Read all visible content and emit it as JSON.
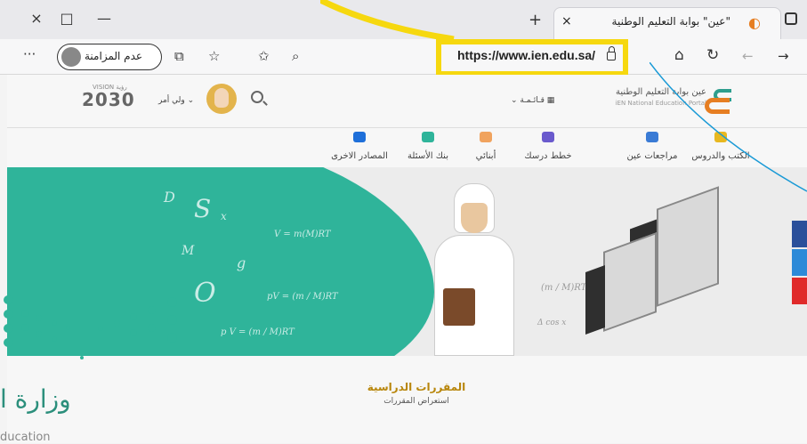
{
  "browser": {
    "tab": {
      "title": "\"عين\" بوابة التعليم الوطنية",
      "close_glyph": "×",
      "favicon": "ien-favicon-icon"
    },
    "window_controls": {
      "close": "×",
      "maximize": "□",
      "minimize": "—"
    },
    "new_tab_glyph": "+",
    "toolbar": {
      "more_glyph": "···",
      "profile_label": "عدم المزامنة",
      "url": "https://www.ien.edu.sa/",
      "icons": [
        "collections-icon",
        "favorites-list-icon",
        "add-favorite-icon",
        "zoom-icon",
        "lock-icon",
        "home-icon",
        "refresh-icon",
        "back-icon",
        "forward-icon"
      ]
    }
  },
  "site": {
    "header": {
      "vision_year": "2030",
      "vision_small": "VISION رؤية",
      "guardian": "ولي أمر ⌄",
      "menu": "⌄ قـائـمـة ▦",
      "portal_name": "عين بوابة التعليم الوطنية",
      "portal_name_en": "iEN National Education Portal"
    },
    "nav": [
      {
        "label": "الكتب والدروس",
        "color": "#e8b820"
      },
      {
        "label": "مراجعات عين",
        "color": "#3a7bd5"
      },
      {
        "label": "خطط درسك",
        "color": "#6a5acd"
      },
      {
        "label": "أبنائي",
        "color": "#f0a35e"
      },
      {
        "label": "بنك الأسئلة",
        "color": "#2fb49a"
      },
      {
        "label": "المصادر الاخرى",
        "color": "#1e6fd9"
      }
    ],
    "courses": {
      "title": "المقررات الدراسية",
      "subtitle": "استعراض المقررات"
    }
  },
  "overlay": {
    "ministry_text": "وزارة ا",
    "education_text": "ducation",
    "highlight_color": "#f6d80f",
    "callout_color": "#1a9ad6",
    "brand_teal": "#2fb49a"
  }
}
